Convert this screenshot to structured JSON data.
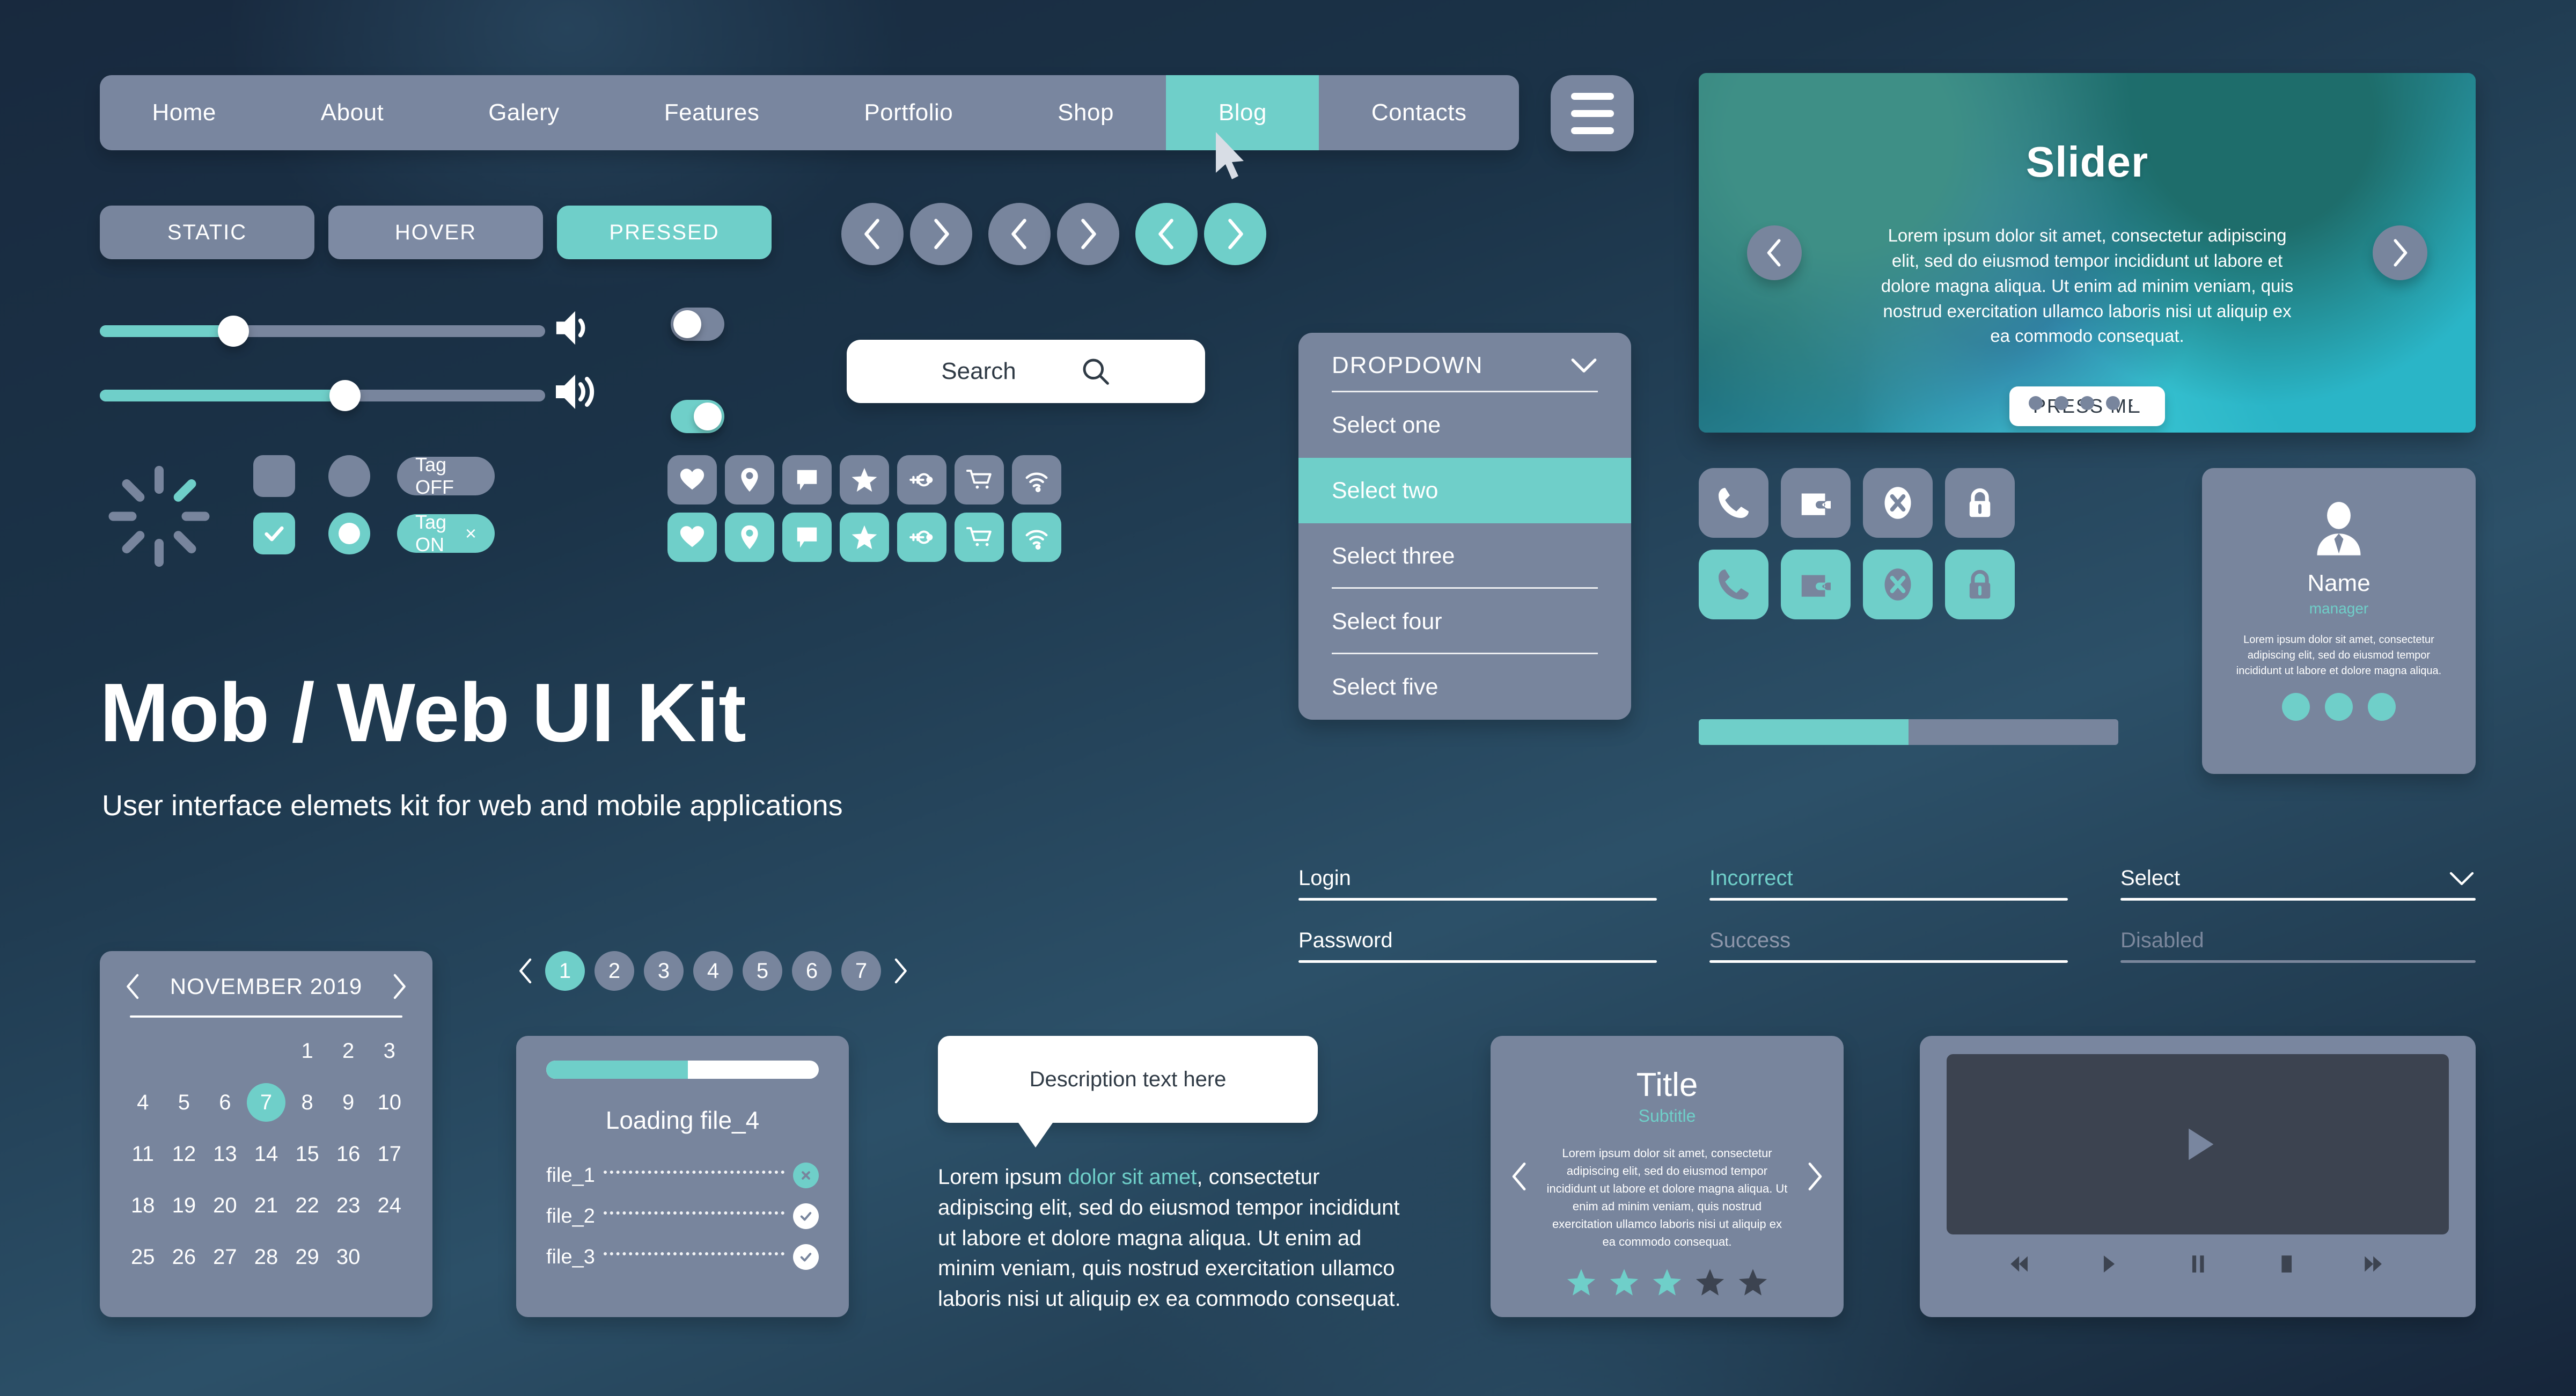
{
  "nav": {
    "items": [
      {
        "label": "Home",
        "active": false
      },
      {
        "label": "About",
        "active": false
      },
      {
        "label": "Galery",
        "active": false
      },
      {
        "label": "Features",
        "active": false
      },
      {
        "label": "Portfolio",
        "active": false
      },
      {
        "label": "Shop",
        "active": false
      },
      {
        "label": "Blog",
        "active": true
      },
      {
        "label": "Contacts",
        "active": false
      }
    ],
    "menu_icon": "hamburger-icon"
  },
  "buttons": {
    "static": "STATIC",
    "hover": "HOVER",
    "pressed": "PRESSED"
  },
  "sliders": [
    {
      "name": "volume-slider-1",
      "value": 30
    },
    {
      "name": "volume-slider-2",
      "value": 55
    }
  ],
  "toggles": [
    {
      "name": "toggle-off",
      "state": "off"
    },
    {
      "name": "toggle-on",
      "state": "on"
    }
  ],
  "tags": {
    "off": "Tag OFF",
    "on": "Tag ON",
    "close_glyph": "×"
  },
  "search": {
    "placeholder": "Search",
    "icon": "search-icon"
  },
  "icon_row_1": [
    "heart-icon",
    "location-pin-icon",
    "chat-bubble-icon",
    "star-icon",
    "key-icon",
    "shopping-cart-icon",
    "wifi-icon"
  ],
  "icon_row_2": [
    "phone-icon",
    "wallet-icon",
    "close-circle-icon",
    "lock-icon"
  ],
  "dropdown": {
    "label": "DROPDOWN",
    "chevron": "chevron-down-icon",
    "options": [
      {
        "label": "Select one",
        "selected": false
      },
      {
        "label": "Select two",
        "selected": true
      },
      {
        "label": "Select three",
        "selected": false
      },
      {
        "label": "Select four",
        "selected": false
      },
      {
        "label": "Select five",
        "selected": false
      }
    ]
  },
  "hero": {
    "title": "Slider",
    "body": "Lorem ipsum dolor sit amet, consectetur adipiscing elit, sed do eiusmod tempor incididunt ut labore et dolore magna aliqua. Ut enim ad minim veniam, quis nostrud exercitation ullamco laboris nisi ut aliquip ex ea commodo consequat.",
    "cta": "PRESS ME",
    "dots_total": 5,
    "dots_active_index": 4
  },
  "progress": {
    "name": "progress-bar",
    "value": 50
  },
  "profile": {
    "avatar": "user-avatar-icon",
    "name": "Name",
    "role": "manager",
    "bio": "Lorem ipsum dolor sit amet, consectetur adipiscing elit, sed do eiusmod tempor incididunt ut labore et dolore magna aliqua.",
    "action_dots": 3
  },
  "kit": {
    "title": "Mob / Web UI Kit",
    "subtitle": "User interface elemets kit for web and mobile applications"
  },
  "form": {
    "col1": [
      {
        "name": "login-field",
        "value": "Login",
        "state": "normal"
      },
      {
        "name": "password-field",
        "value": "Password",
        "state": "normal"
      }
    ],
    "col2": [
      {
        "name": "incorrect-field",
        "value": "Incorrect",
        "state": "accent"
      },
      {
        "name": "success-field",
        "value": "Success",
        "state": "muted"
      }
    ],
    "col3": [
      {
        "name": "select-field",
        "value": "Select",
        "state": "normal",
        "chevron": "chevron-down-icon"
      },
      {
        "name": "disabled-field",
        "value": "Disabled",
        "state": "disabled"
      }
    ]
  },
  "calendar": {
    "month": "NOVEMBER 2019",
    "prev": "chevron-left-icon",
    "next": "chevron-right-icon",
    "lead_blanks": 4,
    "days": [
      1,
      2,
      3,
      4,
      5,
      6,
      7,
      8,
      9,
      10,
      11,
      12,
      13,
      14,
      15,
      16,
      17,
      18,
      19,
      20,
      21,
      22,
      23,
      24,
      25,
      26,
      27,
      28,
      29,
      30
    ],
    "selected_day": 7
  },
  "pagination": {
    "prev": "chevron-left-icon",
    "next": "chevron-right-icon",
    "pages": [
      "1",
      "2",
      "3",
      "4",
      "5",
      "6",
      "7"
    ],
    "active": "1"
  },
  "loading": {
    "progress": 52,
    "title": "Loading file_4",
    "files": [
      {
        "name": "file_1",
        "status": "cancel"
      },
      {
        "name": "file_2",
        "status": "done"
      },
      {
        "name": "file_3",
        "status": "done"
      }
    ]
  },
  "tooltip": {
    "text": "Description text here"
  },
  "paragraph": {
    "lead": "Lorem ipsum ",
    "highlight": "dolor sit amet",
    "rest": ", consectetur adipiscing elit, sed do eiusmod tempor incididunt ut labore et dolore magna aliqua. Ut enim ad minim veniam, quis nostrud exercitation ullamco laboris nisi ut aliquip ex ea commodo consequat."
  },
  "title_card": {
    "title": "Title",
    "subtitle": "Subtitle",
    "body": "Lorem ipsum dolor sit amet, consectetur adipiscing elit, sed do eiusmod tempor incididunt ut labore et dolore magna aliqua. Ut enim ad minim veniam, quis nostrud exercitation ullamco laboris nisi ut aliquip ex ea commodo consequat.",
    "stars_total": 5,
    "stars_filled": 3
  },
  "video": {
    "play": "play-icon",
    "controls": [
      "rewind-icon",
      "play-icon",
      "pause-icon",
      "stop-icon",
      "fast-forward-icon"
    ]
  },
  "colors": {
    "accent": "#6fcfc9",
    "surface": "#78859d",
    "background": "#1d3448",
    "text": "#ffffff",
    "dark": "#3c4350"
  }
}
